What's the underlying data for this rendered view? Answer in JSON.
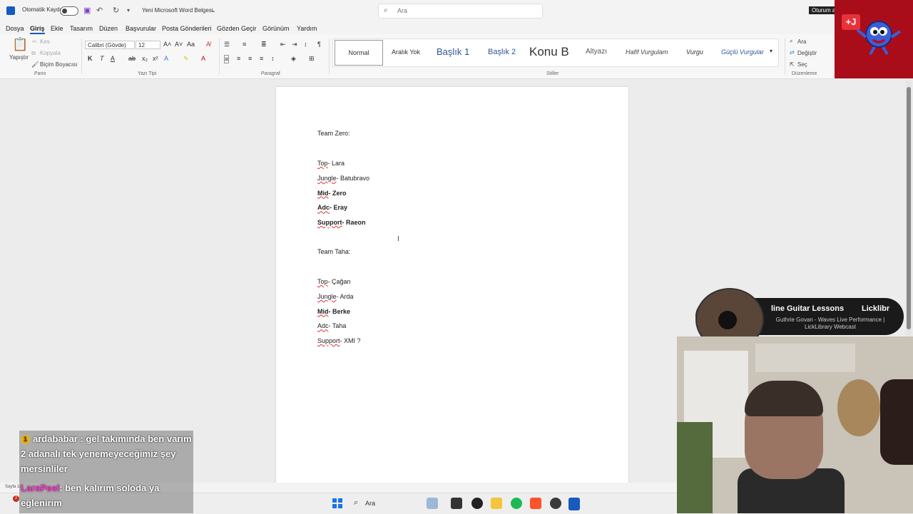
{
  "titlebar": {
    "autosave_label": "Otomatik Kaydet",
    "document_title": "Yeni Microsoft Word Belgesi",
    "search_placeholder": "Ara",
    "signin_label": "Oturum a"
  },
  "menu": {
    "items": [
      "Dosya",
      "Giriş",
      "Ekle",
      "Tasarım",
      "Düzen",
      "Başvurular",
      "Posta Gönderileri",
      "Gözden Geçir",
      "Görünüm",
      "Yardım"
    ],
    "active": "Giriş"
  },
  "ribbon": {
    "clipboard": {
      "paste": "Yapıştır",
      "cut": "Kes",
      "copy": "Kopyala",
      "format_painter": "Biçim Boyacısı",
      "group": "Pano"
    },
    "font": {
      "family": "Calibri (Gövde)",
      "size": "12",
      "bold": "K",
      "italic": "T",
      "group": "Yazı Tipi"
    },
    "paragraph": {
      "group": "Paragraf"
    },
    "styles": {
      "items": [
        "Normal",
        "Aralık Yok",
        "Başlık 1",
        "Başlık 2",
        "Konu B",
        "Altyazı",
        "Hafif Vurgulam",
        "Vurgu",
        "Güçlü Vurgular"
      ],
      "group": "Stiller"
    },
    "editing": {
      "find": "Ara",
      "replace": "Değiştir",
      "select": "Seç",
      "group": "Düzenleme"
    }
  },
  "document": {
    "team1_title": "Team Zero:",
    "team1": [
      {
        "role": "Top",
        "name": "Lara",
        "bold": false
      },
      {
        "role": "Jungle",
        "name": "Batubravo",
        "bold": false
      },
      {
        "role": "Mid",
        "name": "Zero",
        "bold": true
      },
      {
        "role": "Adc",
        "name": "Eray",
        "bold": true
      },
      {
        "role": "Support",
        "name": "Raeon",
        "bold": true
      }
    ],
    "team2_title": "Team Taha:",
    "team2": [
      {
        "role": "Top",
        "name": "Çağan",
        "bold": false
      },
      {
        "role": "Jungle",
        "name": "Arda",
        "bold": false
      },
      {
        "role": "Mid",
        "name": "Berke",
        "bold": true
      },
      {
        "role": "Adc",
        "name": "Taha",
        "bold": false
      },
      {
        "role": "Support",
        "name": "XMI ?",
        "bold": false
      }
    ]
  },
  "overlay": {
    "guitar_title": "line Guitar Lessons",
    "guitar_brand": "Licklibr",
    "guitar_sub": "Guthrie Govan - Waves Live Performance | LickLibrary Webcast",
    "chat": [
      {
        "user": "ardababar",
        "message": " : gel takımında ben varım 2 adanalı tek yenemeyeceğimiz şey mersinliler",
        "coin": "1"
      },
      {
        "user": "LaraPeel",
        "message": ": ben kalırım soloda ya eğlenirim"
      }
    ],
    "logo_text": "+J"
  },
  "status": {
    "text": "Sayfa 1/1"
  },
  "taskbar": {
    "search": "Ara",
    "notification": "2"
  },
  "colors": {
    "accent": "#185abd",
    "red_panel": "#a90d1a",
    "chat_user": "#ff3cd0"
  }
}
